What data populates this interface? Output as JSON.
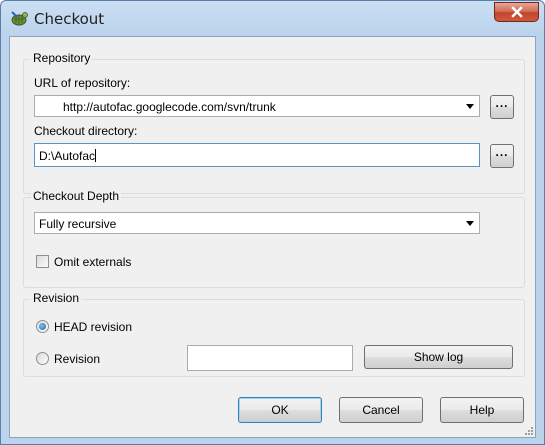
{
  "window": {
    "title": "Checkout"
  },
  "repository": {
    "group_label": "Repository",
    "url_label": "URL of repository:",
    "url_value": "http://autofac.googlecode.com/svn/trunk",
    "url_browse_label": "...",
    "dir_label": "Checkout directory:",
    "dir_value": "D:\\Autofac",
    "dir_browse_label": "..."
  },
  "depth": {
    "group_label": "Checkout Depth",
    "selected": "Fully recursive",
    "omit_externals_label": "Omit externals",
    "omit_externals_checked": false
  },
  "revision": {
    "group_label": "Revision",
    "head_label": "HEAD revision",
    "head_selected": true,
    "revision_label": "Revision",
    "revision_value": "",
    "show_log_label": "Show log"
  },
  "footer": {
    "ok_label": "OK",
    "cancel_label": "Cancel",
    "help_label": "Help"
  }
}
